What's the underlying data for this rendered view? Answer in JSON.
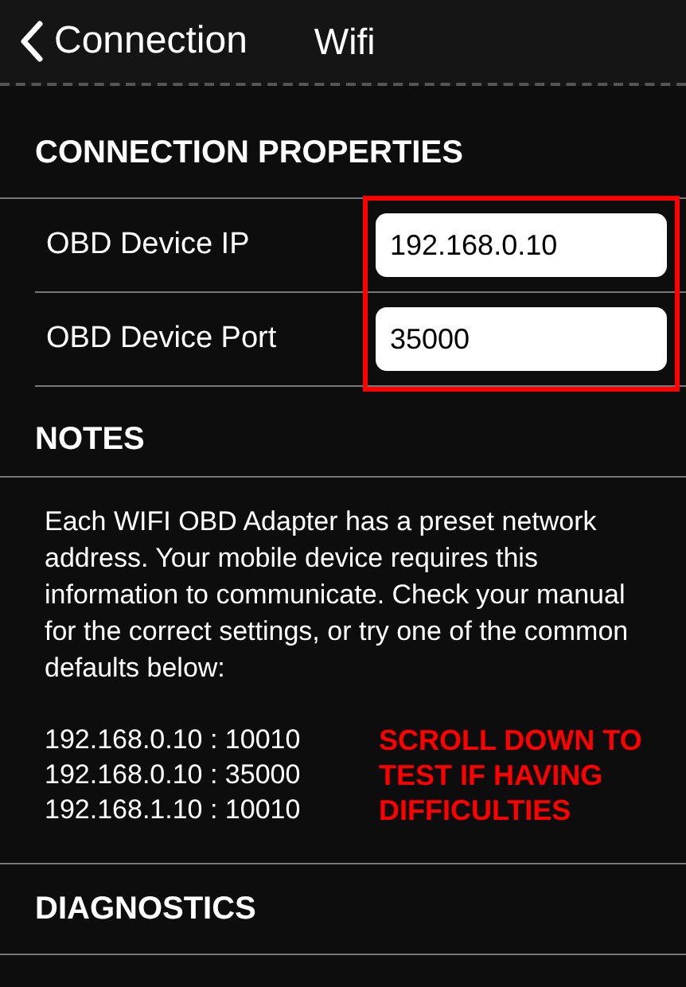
{
  "nav": {
    "back_label": "Connection",
    "title": "Wifi"
  },
  "connection_properties": {
    "header": "CONNECTION PROPERTIES",
    "fields": [
      {
        "label": "OBD Device IP",
        "value": "192.168.0.10"
      },
      {
        "label": "OBD Device Port",
        "value": "35000"
      }
    ],
    "highlighted": true
  },
  "notes": {
    "header": "NOTES",
    "text": "Each WIFI OBD Adapter has a preset network address. Your mobile device requires this information to communicate. Check your manual for the correct settings, or try one of the common defaults below:",
    "defaults": [
      "192.168.0.10 : 10010",
      "192.168.0.10 : 35000",
      "192.168.1.10 : 10010"
    ],
    "warning": "SCROLL DOWN TO TEST IF HAVING DIFFICULTIES"
  },
  "diagnostics": {
    "header": "DIAGNOSTICS"
  }
}
